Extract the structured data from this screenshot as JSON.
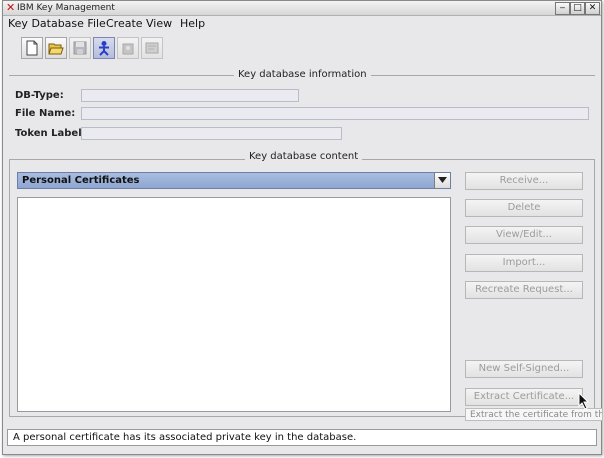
{
  "window": {
    "title": "IBM Key Management",
    "controls": [
      "‒",
      "□",
      "✕"
    ]
  },
  "menu": [
    "Key Database File",
    "Create",
    "View",
    "Help"
  ],
  "toolbar": [
    "new-file-icon",
    "open-folder-icon",
    "save-disk-icon",
    "person-icon",
    "key-database-icon",
    "certificate-icon"
  ],
  "info_section": {
    "title": "Key database information",
    "db_type_label": "DB-Type:",
    "file_name_label": "File Name:",
    "token_label": "Token Label:",
    "db_type_value": "",
    "file_name_value": "",
    "token_value": ""
  },
  "content_section": {
    "title": "Key database content",
    "selected_type": "Personal Certificates"
  },
  "buttons": {
    "receive": "Receive...",
    "delete": "Delete",
    "view_edit": "View/Edit...",
    "import": "Import...",
    "recreate_request": "Recreate Request...",
    "new_self_signed": "New Self-Signed...",
    "extract_certificate": "Extract Certificate..."
  },
  "tooltip": "Extract the certificate from the",
  "status": "A personal certificate has its associated private key in the database."
}
